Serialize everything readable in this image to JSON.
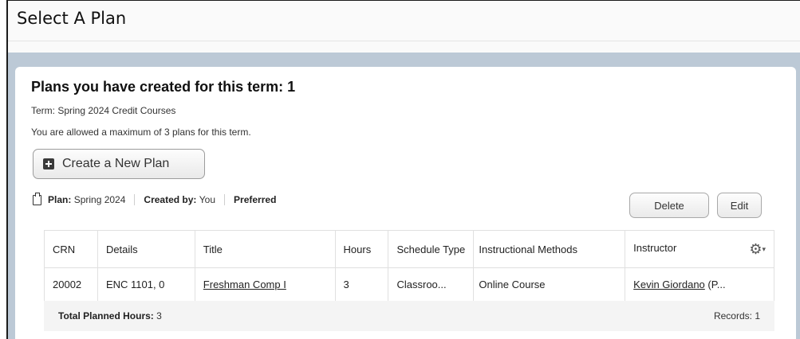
{
  "page": {
    "title": "Select A Plan"
  },
  "plans": {
    "heading": "Plans you have created for this term: 1",
    "term_line": "Term: Spring 2024 Credit Courses",
    "max_line": "You are allowed a maximum of 3 plans for this term.",
    "create_label": "Create a New Plan"
  },
  "plan": {
    "plan_label": "Plan:",
    "plan_value": "Spring 2024",
    "created_label": "Created by:",
    "created_value": "You",
    "preferred": "Preferred"
  },
  "actions": {
    "delete": "Delete",
    "edit": "Edit"
  },
  "table": {
    "headers": [
      "CRN",
      "Details",
      "Title",
      "Hours",
      "Schedule Type",
      "Instructional Methods",
      "Instructor"
    ],
    "rows": [
      {
        "crn": "20002",
        "details": "ENC 1101, 0",
        "title": "Freshman Comp I",
        "hours": "3",
        "schedule_type": "Classroo...",
        "methods": "Online Course",
        "instructor_name": "Kevin Giordano",
        "instructor_suffix": " (P..."
      }
    ],
    "settings_icon": "gear-icon"
  },
  "footer": {
    "total_label": "Total Planned Hours:",
    "total_value": "3",
    "records_label": "Records:",
    "records_value": "1"
  }
}
